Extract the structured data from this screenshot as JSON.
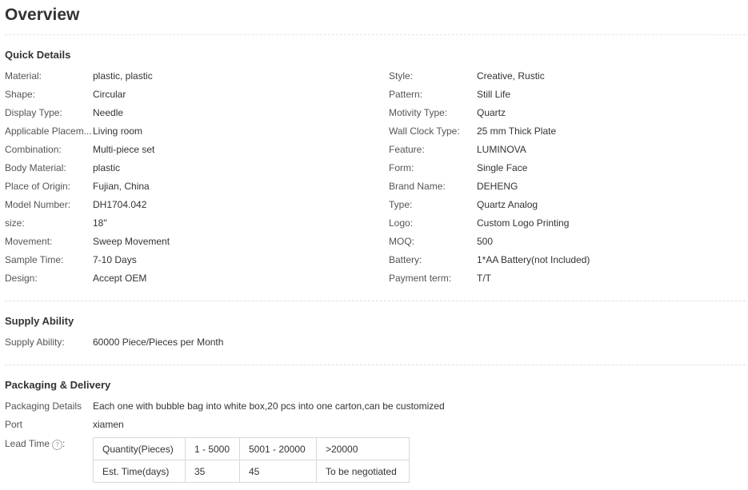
{
  "page_title": "Overview",
  "quick_details": {
    "title": "Quick Details",
    "left": [
      {
        "label": "Material:",
        "value": "plastic, plastic"
      },
      {
        "label": "Shape:",
        "value": "Circular"
      },
      {
        "label": "Display Type:",
        "value": "Needle"
      },
      {
        "label": "Applicable Placem...",
        "value": "Living room"
      },
      {
        "label": "Combination:",
        "value": "Multi-piece set"
      },
      {
        "label": "Body Material:",
        "value": "plastic"
      },
      {
        "label": "Place of Origin:",
        "value": "Fujian, China"
      },
      {
        "label": "Model Number:",
        "value": "DH1704.042"
      },
      {
        "label": "size:",
        "value": "18\""
      },
      {
        "label": "Movement:",
        "value": "Sweep Movement"
      },
      {
        "label": "Sample Time:",
        "value": "7-10 Days"
      },
      {
        "label": "Design:",
        "value": "Accept OEM"
      }
    ],
    "right": [
      {
        "label": "Style:",
        "value": "Creative, Rustic"
      },
      {
        "label": "Pattern:",
        "value": "Still Life"
      },
      {
        "label": "Motivity Type:",
        "value": "Quartz"
      },
      {
        "label": "Wall Clock Type:",
        "value": "25 mm Thick Plate"
      },
      {
        "label": "Feature:",
        "value": "LUMINOVA"
      },
      {
        "label": "Form:",
        "value": "Single Face"
      },
      {
        "label": "Brand Name:",
        "value": "DEHENG"
      },
      {
        "label": "Type:",
        "value": "Quartz Analog"
      },
      {
        "label": "Logo:",
        "value": "Custom Logo Printing"
      },
      {
        "label": "MOQ:",
        "value": "500"
      },
      {
        "label": "Battery:",
        "value": "1*AA Battery(not Included)"
      },
      {
        "label": "Payment term:",
        "value": "T/T"
      }
    ]
  },
  "supply_ability": {
    "title": "Supply Ability",
    "label": "Supply Ability:",
    "value": "60000 Piece/Pieces per Month"
  },
  "packaging": {
    "title": "Packaging & Delivery",
    "details_label": "Packaging Details",
    "details_value": "Each one with bubble bag into white box,20 pcs into one carton,can be customized",
    "port_label": "Port",
    "port_value": "xiamen",
    "lead_time_label": "Lead Time",
    "help_icon": "?",
    "lead_table": {
      "header": [
        "Quantity(Pieces)",
        "1 - 5000",
        "5001 - 20000",
        ">20000"
      ],
      "row": [
        "Est. Time(days)",
        "35",
        "45",
        "To be negotiated"
      ]
    }
  }
}
